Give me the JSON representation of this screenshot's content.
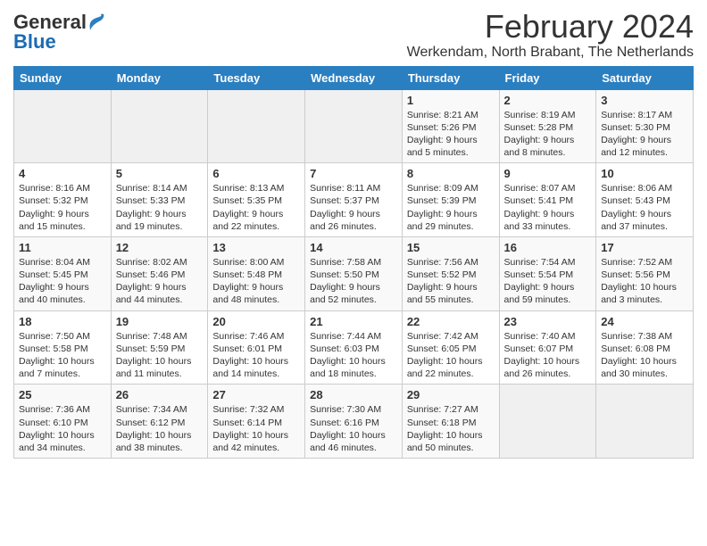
{
  "header": {
    "logo_general": "General",
    "logo_blue": "Blue",
    "month_title": "February 2024",
    "location": "Werkendam, North Brabant, The Netherlands"
  },
  "weekdays": [
    "Sunday",
    "Monday",
    "Tuesday",
    "Wednesday",
    "Thursday",
    "Friday",
    "Saturday"
  ],
  "weeks": [
    [
      {
        "day": "",
        "info": ""
      },
      {
        "day": "",
        "info": ""
      },
      {
        "day": "",
        "info": ""
      },
      {
        "day": "",
        "info": ""
      },
      {
        "day": "1",
        "info": "Sunrise: 8:21 AM\nSunset: 5:26 PM\nDaylight: 9 hours\nand 5 minutes."
      },
      {
        "day": "2",
        "info": "Sunrise: 8:19 AM\nSunset: 5:28 PM\nDaylight: 9 hours\nand 8 minutes."
      },
      {
        "day": "3",
        "info": "Sunrise: 8:17 AM\nSunset: 5:30 PM\nDaylight: 9 hours\nand 12 minutes."
      }
    ],
    [
      {
        "day": "4",
        "info": "Sunrise: 8:16 AM\nSunset: 5:32 PM\nDaylight: 9 hours\nand 15 minutes."
      },
      {
        "day": "5",
        "info": "Sunrise: 8:14 AM\nSunset: 5:33 PM\nDaylight: 9 hours\nand 19 minutes."
      },
      {
        "day": "6",
        "info": "Sunrise: 8:13 AM\nSunset: 5:35 PM\nDaylight: 9 hours\nand 22 minutes."
      },
      {
        "day": "7",
        "info": "Sunrise: 8:11 AM\nSunset: 5:37 PM\nDaylight: 9 hours\nand 26 minutes."
      },
      {
        "day": "8",
        "info": "Sunrise: 8:09 AM\nSunset: 5:39 PM\nDaylight: 9 hours\nand 29 minutes."
      },
      {
        "day": "9",
        "info": "Sunrise: 8:07 AM\nSunset: 5:41 PM\nDaylight: 9 hours\nand 33 minutes."
      },
      {
        "day": "10",
        "info": "Sunrise: 8:06 AM\nSunset: 5:43 PM\nDaylight: 9 hours\nand 37 minutes."
      }
    ],
    [
      {
        "day": "11",
        "info": "Sunrise: 8:04 AM\nSunset: 5:45 PM\nDaylight: 9 hours\nand 40 minutes."
      },
      {
        "day": "12",
        "info": "Sunrise: 8:02 AM\nSunset: 5:46 PM\nDaylight: 9 hours\nand 44 minutes."
      },
      {
        "day": "13",
        "info": "Sunrise: 8:00 AM\nSunset: 5:48 PM\nDaylight: 9 hours\nand 48 minutes."
      },
      {
        "day": "14",
        "info": "Sunrise: 7:58 AM\nSunset: 5:50 PM\nDaylight: 9 hours\nand 52 minutes."
      },
      {
        "day": "15",
        "info": "Sunrise: 7:56 AM\nSunset: 5:52 PM\nDaylight: 9 hours\nand 55 minutes."
      },
      {
        "day": "16",
        "info": "Sunrise: 7:54 AM\nSunset: 5:54 PM\nDaylight: 9 hours\nand 59 minutes."
      },
      {
        "day": "17",
        "info": "Sunrise: 7:52 AM\nSunset: 5:56 PM\nDaylight: 10 hours\nand 3 minutes."
      }
    ],
    [
      {
        "day": "18",
        "info": "Sunrise: 7:50 AM\nSunset: 5:58 PM\nDaylight: 10 hours\nand 7 minutes."
      },
      {
        "day": "19",
        "info": "Sunrise: 7:48 AM\nSunset: 5:59 PM\nDaylight: 10 hours\nand 11 minutes."
      },
      {
        "day": "20",
        "info": "Sunrise: 7:46 AM\nSunset: 6:01 PM\nDaylight: 10 hours\nand 14 minutes."
      },
      {
        "day": "21",
        "info": "Sunrise: 7:44 AM\nSunset: 6:03 PM\nDaylight: 10 hours\nand 18 minutes."
      },
      {
        "day": "22",
        "info": "Sunrise: 7:42 AM\nSunset: 6:05 PM\nDaylight: 10 hours\nand 22 minutes."
      },
      {
        "day": "23",
        "info": "Sunrise: 7:40 AM\nSunset: 6:07 PM\nDaylight: 10 hours\nand 26 minutes."
      },
      {
        "day": "24",
        "info": "Sunrise: 7:38 AM\nSunset: 6:08 PM\nDaylight: 10 hours\nand 30 minutes."
      }
    ],
    [
      {
        "day": "25",
        "info": "Sunrise: 7:36 AM\nSunset: 6:10 PM\nDaylight: 10 hours\nand 34 minutes."
      },
      {
        "day": "26",
        "info": "Sunrise: 7:34 AM\nSunset: 6:12 PM\nDaylight: 10 hours\nand 38 minutes."
      },
      {
        "day": "27",
        "info": "Sunrise: 7:32 AM\nSunset: 6:14 PM\nDaylight: 10 hours\nand 42 minutes."
      },
      {
        "day": "28",
        "info": "Sunrise: 7:30 AM\nSunset: 6:16 PM\nDaylight: 10 hours\nand 46 minutes."
      },
      {
        "day": "29",
        "info": "Sunrise: 7:27 AM\nSunset: 6:18 PM\nDaylight: 10 hours\nand 50 minutes."
      },
      {
        "day": "",
        "info": ""
      },
      {
        "day": "",
        "info": ""
      }
    ]
  ]
}
